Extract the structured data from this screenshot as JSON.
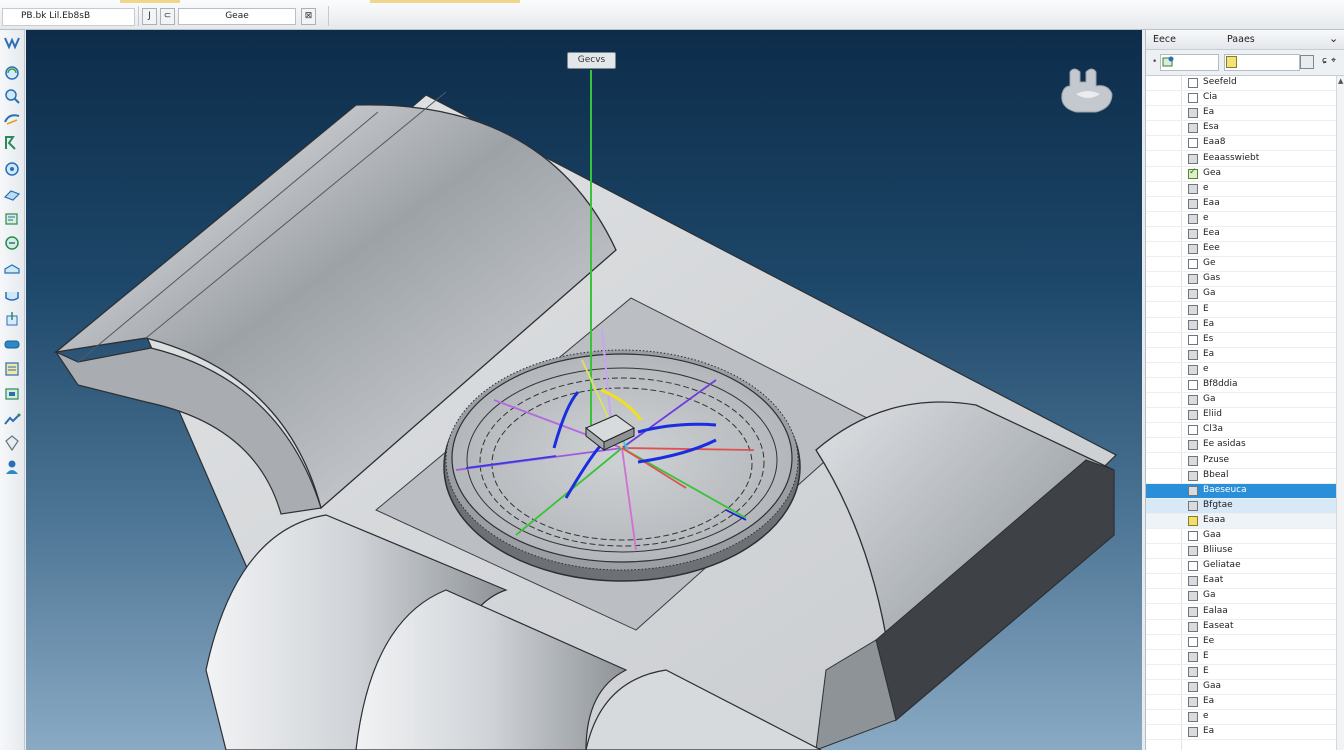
{
  "toolbar": {
    "file_name": "PB.bk Lil.Eb8sB",
    "nav_prev_label": "J",
    "nav_next_label": "⊂",
    "view_value": "Geae",
    "view_button_label": "⊠"
  },
  "left_tools": [
    "select-icon",
    "rotate-view-icon",
    "zoom-view-icon",
    "pan-view-icon",
    "fit-view-icon",
    "sketch-icon",
    "part-icon",
    "measure-icon",
    "section-icon",
    "dimension-icon",
    "fillet-icon",
    "extrude-icon",
    "assembly-icon",
    "draft-icon",
    "mate-icon",
    "probe-icon",
    "explode-icon"
  ],
  "viewport": {
    "axis_label": "Gecvs"
  },
  "panel": {
    "header_col1": "Eece",
    "header_col2": "Paaes",
    "header_collapse": "⌄",
    "filter_text1": "ɕ",
    "filter_text2": "⌖",
    "filter_dot": "•",
    "items": [
      {
        "label": "Seefeld",
        "state": "white"
      },
      {
        "label": "Cia",
        "state": "white"
      },
      {
        "label": "Ea",
        "state": "gray"
      },
      {
        "label": "Esa",
        "state": "gray"
      },
      {
        "label": "Eaa8",
        "state": "white"
      },
      {
        "label": "Eeaasswiebt",
        "state": "gray"
      },
      {
        "label": "Gea",
        "state": "checked"
      },
      {
        "label": "e",
        "state": "gray"
      },
      {
        "label": "Eaa",
        "state": "gray"
      },
      {
        "label": "e",
        "state": "gray"
      },
      {
        "label": "Eea",
        "state": "gray"
      },
      {
        "label": "Eee",
        "state": "gray"
      },
      {
        "label": "Ge",
        "state": "white"
      },
      {
        "label": "Gas",
        "state": "gray"
      },
      {
        "label": "Ga",
        "state": "gray"
      },
      {
        "label": "E",
        "state": "gray"
      },
      {
        "label": "Ea",
        "state": "gray"
      },
      {
        "label": "Es",
        "state": "white"
      },
      {
        "label": "Ea",
        "state": "gray"
      },
      {
        "label": "e",
        "state": "gray"
      },
      {
        "label": "Bf8ddia",
        "state": "white"
      },
      {
        "label": "Ga",
        "state": "gray"
      },
      {
        "label": "Eliid",
        "state": "gray"
      },
      {
        "label": "Cl3a",
        "state": "white"
      },
      {
        "label": "Ee asidas",
        "state": "gray"
      },
      {
        "label": "Pzuse",
        "state": "gray"
      },
      {
        "label": "Bbeal",
        "state": "gray"
      },
      {
        "label": "Baeseuca",
        "state": "gray",
        "selected": true
      },
      {
        "label": "Bfgtae",
        "state": "gray",
        "subsel": true
      },
      {
        "label": "Eaaa",
        "state": "yellow",
        "tint": true
      },
      {
        "label": "Gaa",
        "state": "white"
      },
      {
        "label": "Bliiuse",
        "state": "gray"
      },
      {
        "label": "Geliatae",
        "state": "white"
      },
      {
        "label": "Eaat",
        "state": "gray"
      },
      {
        "label": "Ga",
        "state": "gray"
      },
      {
        "label": "Ealaa",
        "state": "gray"
      },
      {
        "label": "Easeat",
        "state": "gray"
      },
      {
        "label": "Ee",
        "state": "white"
      },
      {
        "label": "E",
        "state": "gray"
      },
      {
        "label": "E",
        "state": "gray"
      },
      {
        "label": "Gaa",
        "state": "gray"
      },
      {
        "label": "Ea",
        "state": "gray"
      },
      {
        "label": "e",
        "state": "gray"
      },
      {
        "label": "Ea",
        "state": "gray"
      }
    ]
  }
}
